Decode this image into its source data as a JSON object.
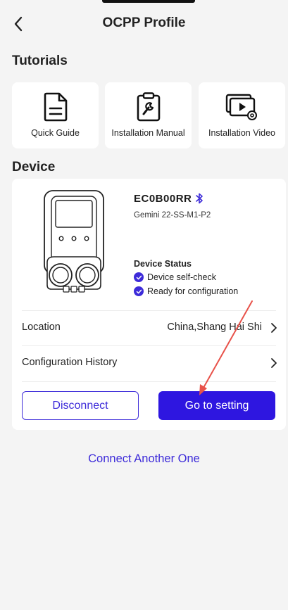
{
  "header": {
    "title": "OCPP Profile",
    "back_icon": "chevron-left-icon"
  },
  "tutorials": {
    "title": "Tutorials",
    "items": [
      {
        "label": "Quick Guide",
        "icon": "document-icon"
      },
      {
        "label": "Installation Manual",
        "icon": "clipboard-wrench-icon"
      },
      {
        "label": "Installation Video",
        "icon": "video-settings-icon"
      }
    ]
  },
  "device": {
    "title": "Device",
    "id": "EC0B00RR",
    "model": "Gemini 22-SS-M1-P2",
    "status_title": "Device Status",
    "status_items": [
      "Device self-check",
      "Ready for configuration"
    ],
    "location_label": "Location",
    "location_value": "China,Shang Hai Shi",
    "history_label": "Configuration History",
    "disconnect_label": "Disconnect",
    "setting_label": "Go to setting"
  },
  "connect_another": "Connect Another One",
  "colors": {
    "accent": "#2e16e0",
    "link": "#3d2bd9",
    "background": "#f4f4f4",
    "annotation_arrow": "#e8524a"
  }
}
